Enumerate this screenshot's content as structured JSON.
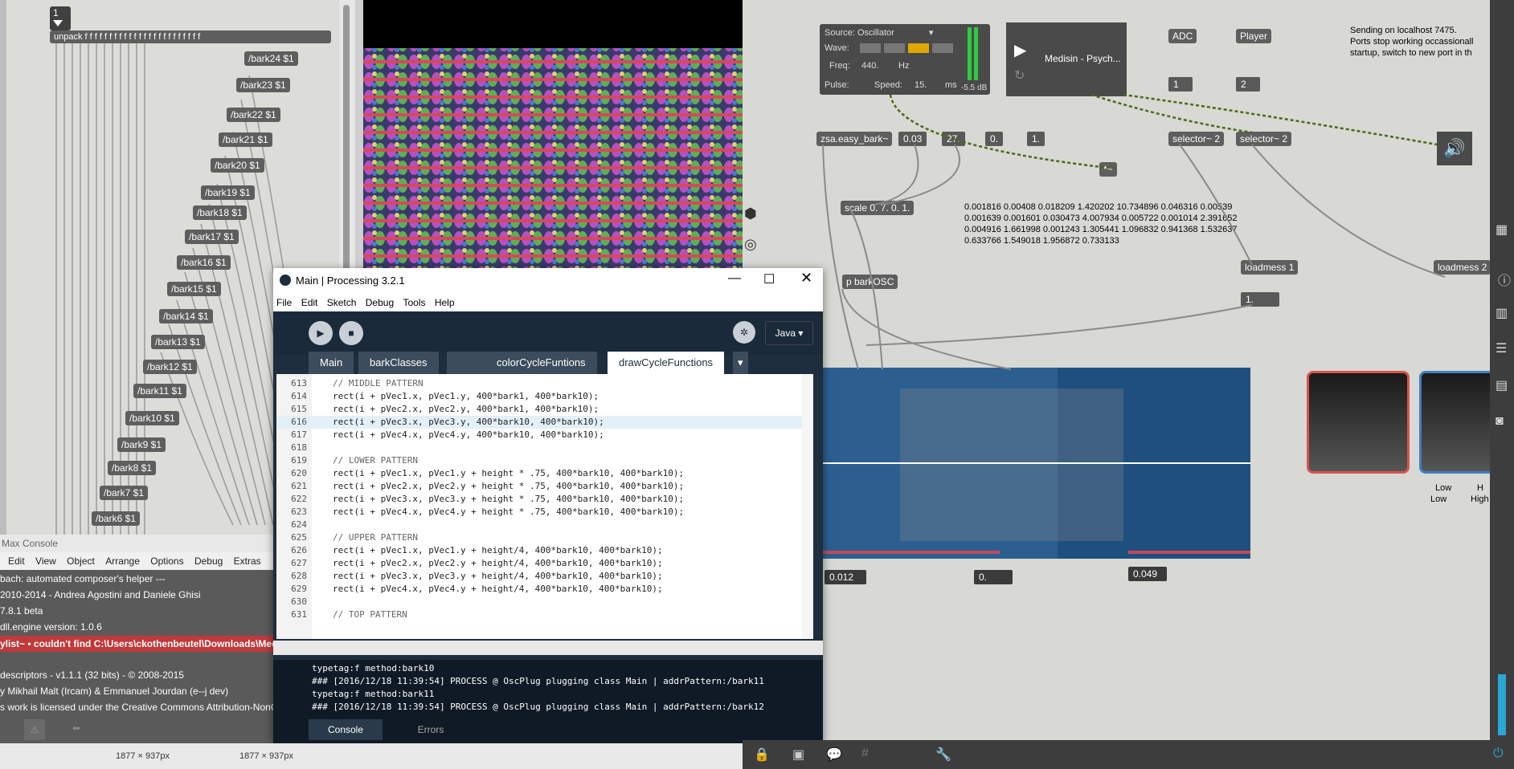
{
  "left_patch": {
    "msg_top": "1",
    "unpack_label": "unpack f f f f f f f f f f f f f f f f f f f f f f f f",
    "bark_messages": [
      "/bark24 $1",
      "/bark23 $1",
      "/bark22 $1",
      "/bark21 $1",
      "/bark20 $1",
      "/bark19 $1",
      "/bark18 $1",
      "/bark17 $1",
      "/bark16 $1",
      "/bark15 $1",
      "/bark14 $1",
      "/bark13 $1",
      "/bark12 $1",
      "/bark11 $1",
      "/bark10 $1",
      "/bark9 $1",
      "/bark8 $1",
      "/bark7 $1",
      "/bark6 $1"
    ]
  },
  "max_console": {
    "title": "Max Console",
    "menu": [
      "Edit",
      "View",
      "Object",
      "Arrange",
      "Options",
      "Debug",
      "Extras"
    ],
    "lines": [
      "bach: automated composer's helper ---",
      "2010-2014 - Andrea Agostini and Daniele Ghisi",
      "7.8.1 beta",
      "dll.engine version: 1.0.6",
      "ylist~  •  couldn't find C:\\Users\\ckothenbeutel\\Downloads\\Medisin",
      "descriptors - v1.1.1 (32 bits) - © 2008-2015",
      "y Mikhail Malt (Ircam) & Emmanuel Jourdan (e--j dev)",
      "s work is licensed under the Creative Commons Attribution-NonC"
    ]
  },
  "processing": {
    "title": "Main | Processing 3.2.1",
    "menu": [
      "File",
      "Edit",
      "Sketch",
      "Debug",
      "Tools",
      "Help"
    ],
    "mode": "Java",
    "tabs": [
      "Main",
      "barkClasses",
      "",
      "colorCycleFuntions",
      "drawCycleFunctions"
    ],
    "active_tab": "drawCycleFunctions",
    "code_lines": [
      {
        "n": "613",
        "t": "// MIDDLE PATTERN"
      },
      {
        "n": "614",
        "t": "rect(i + pVec1.x, pVec1.y, 400*bark1, 400*bark10);"
      },
      {
        "n": "615",
        "t": "rect(i + pVec2.x, pVec2.y, 400*bark1, 400*bark10);"
      },
      {
        "n": "616",
        "t": "rect(i + pVec3.x, pVec3.y, 400*bark10, 400*bark10);"
      },
      {
        "n": "617",
        "t": "rect(i + pVec4.x, pVec4.y, 400*bark10, 400*bark10);"
      },
      {
        "n": "618",
        "t": ""
      },
      {
        "n": "619",
        "t": "// LOWER PATTERN"
      },
      {
        "n": "620",
        "t": "rect(i + pVec1.x, pVec1.y + height * .75, 400*bark10, 400*bark10);"
      },
      {
        "n": "621",
        "t": "rect(i + pVec2.x, pVec2.y + height * .75, 400*bark10, 400*bark10);"
      },
      {
        "n": "622",
        "t": "rect(i + pVec3.x, pVec3.y + height * .75, 400*bark10, 400*bark10);"
      },
      {
        "n": "623",
        "t": "rect(i + pVec4.x, pVec4.y + height * .75, 400*bark10, 400*bark10);"
      },
      {
        "n": "624",
        "t": ""
      },
      {
        "n": "625",
        "t": "// UPPER PATTERN"
      },
      {
        "n": "626",
        "t": "rect(i + pVec1.x, pVec1.y + height/4, 400*bark10, 400*bark10);"
      },
      {
        "n": "627",
        "t": "rect(i + pVec2.x, pVec2.y + height/4, 400*bark10, 400*bark10);"
      },
      {
        "n": "628",
        "t": "rect(i + pVec3.x, pVec3.y + height/4, 400*bark10, 400*bark10);"
      },
      {
        "n": "629",
        "t": "rect(i + pVec4.x, pVec4.y + height/4, 400*bark10, 400*bark10);"
      },
      {
        "n": "630",
        "t": ""
      },
      {
        "n": "631",
        "t": "// TOP PATTERN"
      }
    ],
    "console_lines": [
      "typetag:f method:bark10",
      "### [2016/12/18 11:39:54] PROCESS @ OscPlug plugging class Main | addrPattern:/bark11",
      "typetag:f method:bark11",
      "### [2016/12/18 11:39:54] PROCESS @ OscPlug plugging class Main | addrPattern:/bark12"
    ],
    "console_tabs": [
      "Console",
      "Errors"
    ]
  },
  "right_patch": {
    "source_label": "Source: Oscillator",
    "wave_label": "Wave:",
    "freq_label": "Freq:",
    "freq_value": "440.",
    "freq_unit": "Hz",
    "pulse_label": "Pulse:",
    "speed_label": "Speed:",
    "speed_value": "15.",
    "speed_unit": "ms",
    "db_value": "-5.5 dB",
    "player_title": "Medisin - Psych...",
    "adc": "ADC",
    "player": "Player",
    "num1": "1",
    "num2": "2",
    "selector1": "selector~ 2",
    "selector2": "selector~ 2",
    "zsa": "zsa.easy_bark~",
    "n003": "0.03",
    "n27": "27.",
    "n0": "0.",
    "n1": "1.",
    "times": "*~",
    "scale": "scale 0. 7. 0. 1.",
    "pbark": "p barkOSC",
    "loadmess1": "loadmess 1",
    "loadmess2": "loadmess 2",
    "n1b": "1.",
    "sending": "Sending on localhost 7475.",
    "ports": "Ports stop working occassionall",
    "startup": "startup, switch to new port in th",
    "data_lines": [
      "0.001816 0.00408 0.018209 1.420202 10.734896 0.046316 0.00539",
      "0.001639 0.001601 0.030473 4.007934 0.005722 0.001014 2.391652",
      "0.004916 1.661998 0.001243 1.305441 1.096832 0.941368 1.532637",
      "0.633766 1.549018 1.956872 0.733133"
    ],
    "val1": "0.012",
    "val2": "0.",
    "val3": "0.049",
    "low": "Low",
    "low2": "Low",
    "high": "H",
    "high2": "High"
  },
  "status": {
    "dim1": "1877 × 937px",
    "dim2": "1877 × 937px"
  }
}
